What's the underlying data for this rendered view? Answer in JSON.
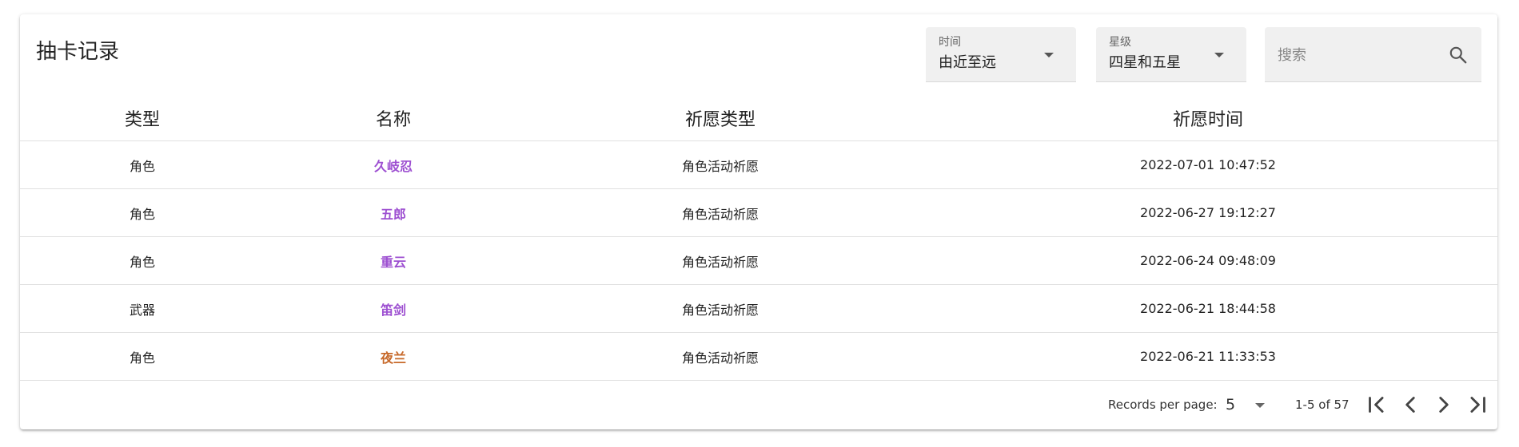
{
  "header": {
    "title": "抽卡记录",
    "time_filter": {
      "label": "时间",
      "value": "由近至远"
    },
    "star_filter": {
      "label": "星级",
      "value": "四星和五星"
    },
    "search": {
      "placeholder": "搜索",
      "value": ""
    }
  },
  "table": {
    "columns": [
      "类型",
      "名称",
      "祈愿类型",
      "祈愿时间"
    ],
    "rows": [
      {
        "type": "角色",
        "name": "久岐忍",
        "wish_type": "角色活动祈愿",
        "time": "2022-07-01 10:47:52",
        "name_color": "#9d4fd1"
      },
      {
        "type": "角色",
        "name": "五郎",
        "wish_type": "角色活动祈愿",
        "time": "2022-06-27 19:12:27",
        "name_color": "#9d4fd1"
      },
      {
        "type": "角色",
        "name": "重云",
        "wish_type": "角色活动祈愿",
        "time": "2022-06-24 09:48:09",
        "name_color": "#9d4fd1"
      },
      {
        "type": "武器",
        "name": "笛剑",
        "wish_type": "角色活动祈愿",
        "time": "2022-06-21 18:44:58",
        "name_color": "#9d4fd1"
      },
      {
        "type": "角色",
        "name": "夜兰",
        "wish_type": "角色活动祈愿",
        "time": "2022-06-21 11:33:53",
        "name_color": "#c7692a"
      }
    ]
  },
  "footer": {
    "records_per_page_label": "Records per page:",
    "records_per_page": "5",
    "range_text": "1-5 of 57"
  },
  "icons": {
    "search": "search-icon",
    "first": "first-page-icon",
    "prev": "chevron-left-icon",
    "next": "chevron-right-icon",
    "last": "last-page-icon",
    "dropdown": "caret-down-icon"
  }
}
